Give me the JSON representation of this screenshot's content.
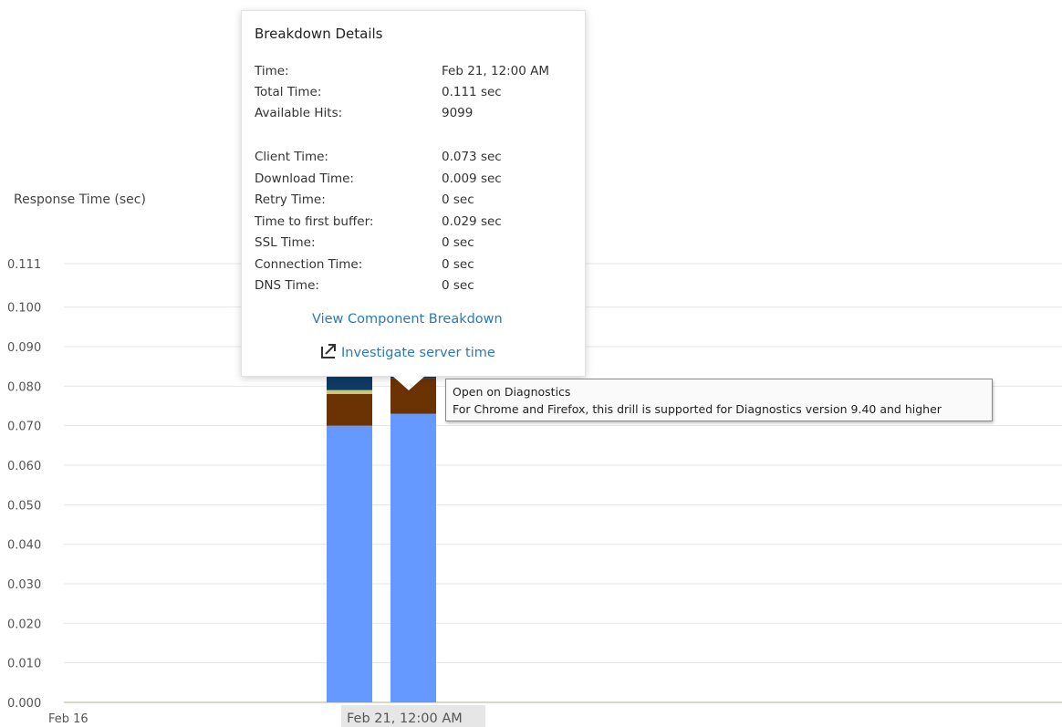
{
  "chart_data": {
    "type": "bar",
    "stacked": true,
    "ylabel": "Response Time (sec)",
    "ylim": [
      0,
      0.111
    ],
    "y_ticks": [
      "0.000",
      "0.010",
      "0.020",
      "0.030",
      "0.040",
      "0.050",
      "0.060",
      "0.070",
      "0.080",
      "0.090",
      "0.100",
      "0.111"
    ],
    "x_tick_labels": [
      "Feb 16",
      "Feb 21, 12:00 AM"
    ],
    "grid": true,
    "categories": [
      "bar-1",
      "bar-2"
    ],
    "series": [
      {
        "color": "#6699ff",
        "values": [
          0.07,
          0.073
        ]
      },
      {
        "color": "#6b3204",
        "values": [
          0.008,
          0.009
        ]
      },
      {
        "color": "#c8c87a",
        "values": [
          0.001,
          0
        ]
      },
      {
        "color": "#0e3a66",
        "values": [
          0.032,
          0.029
        ]
      }
    ]
  },
  "tooltip": {
    "title": "Breakdown Details",
    "rows_top": [
      {
        "label": "Time:",
        "value": "Feb 21, 12:00 AM"
      },
      {
        "label": "Total Time:",
        "value": "0.111 sec"
      },
      {
        "label": "Available Hits:",
        "value": "9099"
      }
    ],
    "rows_breakdown": [
      {
        "label": "Client Time:",
        "value": "0.073 sec"
      },
      {
        "label": "Download Time:",
        "value": "0.009 sec"
      },
      {
        "label": "Retry Time:",
        "value": "0 sec"
      },
      {
        "label": "Time to first buffer:",
        "value": "0.029 sec"
      },
      {
        "label": "SSL Time:",
        "value": "0 sec"
      },
      {
        "label": "Connection Time:",
        "value": "0 sec"
      },
      {
        "label": "DNS Time:",
        "value": "0 sec"
      }
    ],
    "view_component_link": "View Component Breakdown",
    "investigate_link": "Investigate server time",
    "investigate_icon": "external-link-icon"
  },
  "hint": {
    "line1": "Open on Diagnostics",
    "line2": "For Chrome and Firefox, this drill is supported for Diagnostics version 9.40 and higher"
  },
  "colors": {
    "link": "#2a7ab8",
    "grid": "#e6e6e6",
    "axis_text": "#555555"
  }
}
